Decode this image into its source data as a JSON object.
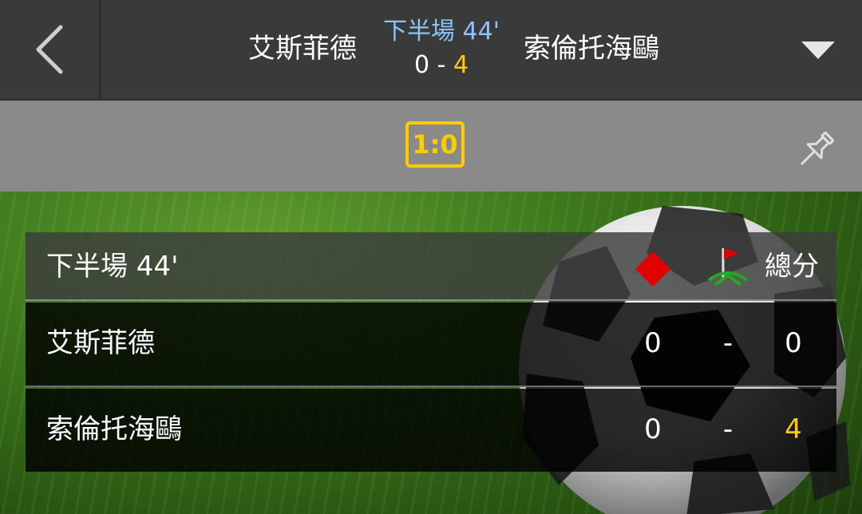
{
  "header": {
    "home_team": "艾斯菲德",
    "away_team": "索倫托海鷗",
    "period": "下半場 44'",
    "home_score": "0",
    "score_separator": " - ",
    "away_score": "4"
  },
  "sub_bar": {
    "badge": "1:0"
  },
  "stats": {
    "period_label": "下半場 44'",
    "total_label": "總分",
    "rows": [
      {
        "team": "艾斯菲德",
        "red_cards": "0",
        "dash": "-",
        "total": "0"
      },
      {
        "team": "索倫托海鷗",
        "red_cards": "0",
        "dash": "-",
        "total": "4"
      }
    ]
  },
  "icons": {
    "back": "chevron-left-icon",
    "dropdown": "triangle-down-icon",
    "pin": "pin-icon",
    "red_card": "red-card-icon",
    "corner": "corner-flag-icon"
  },
  "colors": {
    "accent_yellow": "#ffcc00",
    "period_blue": "#8cc4ff",
    "header_bg": "#3a3a3a",
    "subbar_bg": "#8a8a8a",
    "red_card": "#e00000",
    "corner_green": "#22aa22"
  }
}
